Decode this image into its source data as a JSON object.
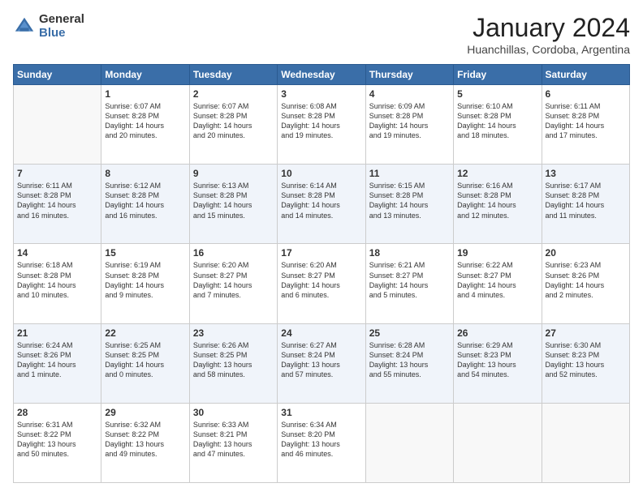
{
  "logo": {
    "general": "General",
    "blue": "Blue"
  },
  "title": "January 2024",
  "location": "Huanchillas, Cordoba, Argentina",
  "days_of_week": [
    "Sunday",
    "Monday",
    "Tuesday",
    "Wednesday",
    "Thursday",
    "Friday",
    "Saturday"
  ],
  "weeks": [
    [
      {
        "day": "",
        "detail": ""
      },
      {
        "day": "1",
        "detail": "Sunrise: 6:07 AM\nSunset: 8:28 PM\nDaylight: 14 hours\nand 20 minutes."
      },
      {
        "day": "2",
        "detail": "Sunrise: 6:07 AM\nSunset: 8:28 PM\nDaylight: 14 hours\nand 20 minutes."
      },
      {
        "day": "3",
        "detail": "Sunrise: 6:08 AM\nSunset: 8:28 PM\nDaylight: 14 hours\nand 19 minutes."
      },
      {
        "day": "4",
        "detail": "Sunrise: 6:09 AM\nSunset: 8:28 PM\nDaylight: 14 hours\nand 19 minutes."
      },
      {
        "day": "5",
        "detail": "Sunrise: 6:10 AM\nSunset: 8:28 PM\nDaylight: 14 hours\nand 18 minutes."
      },
      {
        "day": "6",
        "detail": "Sunrise: 6:11 AM\nSunset: 8:28 PM\nDaylight: 14 hours\nand 17 minutes."
      }
    ],
    [
      {
        "day": "7",
        "detail": "Sunrise: 6:11 AM\nSunset: 8:28 PM\nDaylight: 14 hours\nand 16 minutes."
      },
      {
        "day": "8",
        "detail": "Sunrise: 6:12 AM\nSunset: 8:28 PM\nDaylight: 14 hours\nand 16 minutes."
      },
      {
        "day": "9",
        "detail": "Sunrise: 6:13 AM\nSunset: 8:28 PM\nDaylight: 14 hours\nand 15 minutes."
      },
      {
        "day": "10",
        "detail": "Sunrise: 6:14 AM\nSunset: 8:28 PM\nDaylight: 14 hours\nand 14 minutes."
      },
      {
        "day": "11",
        "detail": "Sunrise: 6:15 AM\nSunset: 8:28 PM\nDaylight: 14 hours\nand 13 minutes."
      },
      {
        "day": "12",
        "detail": "Sunrise: 6:16 AM\nSunset: 8:28 PM\nDaylight: 14 hours\nand 12 minutes."
      },
      {
        "day": "13",
        "detail": "Sunrise: 6:17 AM\nSunset: 8:28 PM\nDaylight: 14 hours\nand 11 minutes."
      }
    ],
    [
      {
        "day": "14",
        "detail": "Sunrise: 6:18 AM\nSunset: 8:28 PM\nDaylight: 14 hours\nand 10 minutes."
      },
      {
        "day": "15",
        "detail": "Sunrise: 6:19 AM\nSunset: 8:28 PM\nDaylight: 14 hours\nand 9 minutes."
      },
      {
        "day": "16",
        "detail": "Sunrise: 6:20 AM\nSunset: 8:27 PM\nDaylight: 14 hours\nand 7 minutes."
      },
      {
        "day": "17",
        "detail": "Sunrise: 6:20 AM\nSunset: 8:27 PM\nDaylight: 14 hours\nand 6 minutes."
      },
      {
        "day": "18",
        "detail": "Sunrise: 6:21 AM\nSunset: 8:27 PM\nDaylight: 14 hours\nand 5 minutes."
      },
      {
        "day": "19",
        "detail": "Sunrise: 6:22 AM\nSunset: 8:27 PM\nDaylight: 14 hours\nand 4 minutes."
      },
      {
        "day": "20",
        "detail": "Sunrise: 6:23 AM\nSunset: 8:26 PM\nDaylight: 14 hours\nand 2 minutes."
      }
    ],
    [
      {
        "day": "21",
        "detail": "Sunrise: 6:24 AM\nSunset: 8:26 PM\nDaylight: 14 hours\nand 1 minute."
      },
      {
        "day": "22",
        "detail": "Sunrise: 6:25 AM\nSunset: 8:25 PM\nDaylight: 14 hours\nand 0 minutes."
      },
      {
        "day": "23",
        "detail": "Sunrise: 6:26 AM\nSunset: 8:25 PM\nDaylight: 13 hours\nand 58 minutes."
      },
      {
        "day": "24",
        "detail": "Sunrise: 6:27 AM\nSunset: 8:24 PM\nDaylight: 13 hours\nand 57 minutes."
      },
      {
        "day": "25",
        "detail": "Sunrise: 6:28 AM\nSunset: 8:24 PM\nDaylight: 13 hours\nand 55 minutes."
      },
      {
        "day": "26",
        "detail": "Sunrise: 6:29 AM\nSunset: 8:23 PM\nDaylight: 13 hours\nand 54 minutes."
      },
      {
        "day": "27",
        "detail": "Sunrise: 6:30 AM\nSunset: 8:23 PM\nDaylight: 13 hours\nand 52 minutes."
      }
    ],
    [
      {
        "day": "28",
        "detail": "Sunrise: 6:31 AM\nSunset: 8:22 PM\nDaylight: 13 hours\nand 50 minutes."
      },
      {
        "day": "29",
        "detail": "Sunrise: 6:32 AM\nSunset: 8:22 PM\nDaylight: 13 hours\nand 49 minutes."
      },
      {
        "day": "30",
        "detail": "Sunrise: 6:33 AM\nSunset: 8:21 PM\nDaylight: 13 hours\nand 47 minutes."
      },
      {
        "day": "31",
        "detail": "Sunrise: 6:34 AM\nSunset: 8:20 PM\nDaylight: 13 hours\nand 46 minutes."
      },
      {
        "day": "",
        "detail": ""
      },
      {
        "day": "",
        "detail": ""
      },
      {
        "day": "",
        "detail": ""
      }
    ]
  ]
}
